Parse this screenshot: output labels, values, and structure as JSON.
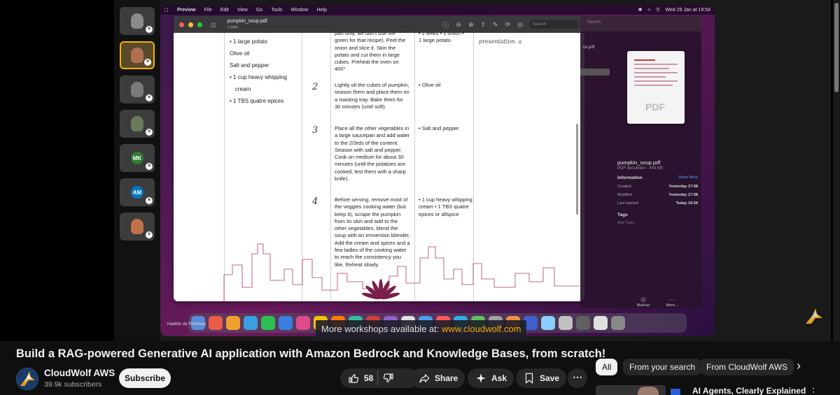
{
  "video": {
    "mac_menubar": {
      "app": "Preview",
      "menus": [
        "File",
        "Edit",
        "View",
        "Go",
        "Tools",
        "Window",
        "Help"
      ],
      "clock": "Wed 29 Jan at 19:54"
    },
    "preview": {
      "filename": "pumpkin_soup.pdf",
      "pages": "1 page",
      "search_placeholder": "Search"
    },
    "recipe": {
      "left_ingredients": [
        "• 1 large potato",
        "Olive oil",
        "Salt and pepper",
        "• 1 cup heavy whipping",
        "cream",
        "• 1 TBS quatre epices"
      ],
      "steps": [
        {
          "num": "2",
          "text": "Lightly oil the cubes of pumpkin, season them and place them on a roasting tray. Bake them for 30 minutes (until soft).",
          "ingredients": "• Olive oil"
        },
        {
          "num": "3",
          "text": "Place all the other vegetables in a large saucepan and add water to the 2/3rds of the content. Season with salt and pepper. Cook on medium for about 30 minutes (until the potatoes are cooked, test them with a sharp knife).",
          "ingredients": "• Salt and pepper"
        },
        {
          "num": "4",
          "text": "Before serving, remove most of the veggies cooking water (but keep it), scrape the pumpkin from its skin and add to the other vegetables, blend the soup with an immersion blender. Add the cream and spices and a few ladles of the cooking water to reach the consistency you like. Reheat slowly.",
          "ingredients": "• 1 cup heavy whipping cream • 1 TBS quatre epices or allspice"
        }
      ],
      "step1_tail": "part only, we don't use the green for that recipe). Peel the onion and slice it. Skin the potato and cut them in large cubes. Preheat the oven on 400°",
      "step1_ingredients": "• 2 leeks • 1 onion • 1 large potato",
      "note": "presentation. a"
    },
    "finder": {
      "search": "Search",
      "side_label": "ce.pdf",
      "file_name": "pumpkin_soup.pdf",
      "file_kind": "PDF document - 443 KB",
      "info_title": "Information",
      "show_more": "Show More",
      "rows": [
        {
          "label": "Created",
          "value": "Yesterday 17:58"
        },
        {
          "label": "Modified",
          "value": "Yesterday 17:58"
        },
        {
          "label": "Last opened",
          "value": "Today 19:54"
        }
      ],
      "tags_title": "Tags",
      "tags_placeholder": "Add Tags...",
      "markup_label": "Markup",
      "more_label": "More...",
      "thumb_badge": "PDF"
    },
    "participants": [
      {
        "type": "face",
        "color": "#8a8a8a"
      },
      {
        "type": "face",
        "color": "#b07050",
        "active": true
      },
      {
        "type": "face",
        "color": "#7a7a7a"
      },
      {
        "type": "face",
        "color": "#6a7a5a"
      },
      {
        "type": "initials",
        "text": "MK",
        "color": "#2e7d32"
      },
      {
        "type": "initials",
        "text": "AM",
        "color": "#0277bd"
      },
      {
        "type": "face",
        "color": "#c0704a"
      }
    ],
    "speaker_name": "Hadelin de Ponteves",
    "workshop_text": "More workshops available at: ",
    "workshop_link": "www.cloudwolf.com"
  },
  "title": "Build a RAG-powered Generative AI application with Amazon Bedrock and Knowledge Bases, from scratch!",
  "channel": {
    "name": "CloudWolf AWS",
    "subscribers": "39.9k subscribers",
    "subscribe_label": "Subscribe"
  },
  "actions": {
    "likes": "58",
    "share": "Share",
    "ask": "Ask",
    "save": "Save"
  },
  "chips": [
    "All",
    "From your search",
    "From CloudWolf AWS"
  ],
  "recommendation": {
    "title": "AI Agents, Clearly Explained"
  },
  "colors": {
    "background": "#0f0f0f",
    "accent": "#f2a900",
    "pill": "#272727"
  }
}
